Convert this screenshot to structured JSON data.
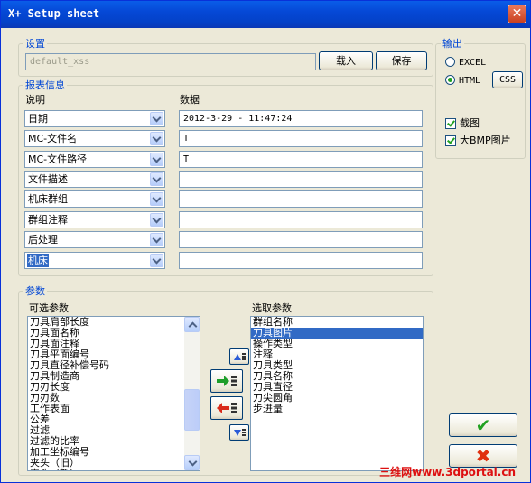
{
  "window": {
    "title": "X+ Setup sheet",
    "close_glyph": "✕"
  },
  "settings": {
    "group_label": "设置",
    "template_value": "default_xss",
    "load_label": "载入",
    "save_label": "保存"
  },
  "output": {
    "group_label": "输出",
    "excel_label": "EXCEL",
    "html_label": "HTML",
    "css_label": "CSS",
    "selected": "HTML",
    "screenshot_label": "截图",
    "screenshot_checked": true,
    "bmp_label": "大BMP图片",
    "bmp_checked": true
  },
  "report": {
    "group_label": "报表信息",
    "col_desc": "说明",
    "col_data": "数据",
    "rows": [
      {
        "desc": "日期",
        "value": "2012-3-29 - 11:47:24"
      },
      {
        "desc": "MC-文件名",
        "value": "T"
      },
      {
        "desc": "MC-文件路径",
        "value": "T"
      },
      {
        "desc": "文件描述",
        "value": ""
      },
      {
        "desc": "机床群组",
        "value": ""
      },
      {
        "desc": "群组注释",
        "value": ""
      },
      {
        "desc": "后处理",
        "value": ""
      },
      {
        "desc": "机床",
        "value": ""
      }
    ]
  },
  "params": {
    "group_label": "参数",
    "available_label": "可选参数",
    "selected_label": "选取参数",
    "available": [
      "刀具肩部长度",
      "刀具面名称",
      "刀具面注释",
      "刀具平面编号",
      "刀具直径补偿号码",
      "刀具制造商",
      "刀刃长度",
      "刀刃数",
      "工作表面",
      "公差",
      "过滤",
      "过滤的比率",
      "加工坐标编号",
      "夹头（旧）",
      "夹头（新）"
    ],
    "selected": [
      "群组名称",
      "刀具图片",
      "操作类型",
      "注释",
      "刀具类型",
      "刀具名称",
      "刀具直径",
      "刀尖圆角",
      "步进量"
    ],
    "selected_index": 1
  },
  "dialog": {
    "ok_glyph": "✔",
    "cancel_glyph": "✖"
  },
  "watermark": "三维网www.3dportal.cn",
  "colors": {
    "ok_green": "#21a121",
    "cancel_red": "#e03010",
    "accent_blue": "#316ac5"
  }
}
